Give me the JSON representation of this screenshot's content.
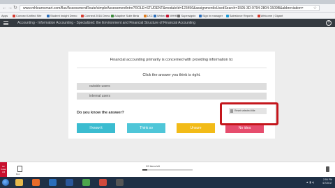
{
  "browser": {
    "url": "www.mhlearnsmart.com/flux/AssessmentRoute/simpleAssessmentIntro?ROLE=STUDENT&moduleId=123456&assignmentIsUsedSearch=1505-3D-9794-2804-1509B&abbreviation=",
    "nav_glyphs": [
      "←",
      "→",
      "↻"
    ],
    "bookmarks_label": "Apps",
    "bookmarks": [
      {
        "label": "Connect Unified Site",
        "color": "#d63b2f"
      },
      {
        "label": "Student Insight Demo",
        "color": "#2a6ebb"
      },
      {
        "label": "Connect 2016 Demo",
        "color": "#d63b2f"
      },
      {
        "label": "Adaptive Suite Beta",
        "color": "#3b8b3b"
      },
      {
        "label": "LXC",
        "color": "#e07b1a"
      },
      {
        "label": "Webex",
        "color": "#2a6ebb"
      },
      {
        "label": "MHHE",
        "color": "#c8102e"
      },
      {
        "label": "Supersignin",
        "color": "#6b6b6b"
      },
      {
        "label": "Sign in manager",
        "color": "#2a6ebb"
      },
      {
        "label": "Salesforce Reports",
        "color": "#1a9ad6"
      },
      {
        "label": "Welcome | Gigant",
        "color": "#d63b2f"
      }
    ]
  },
  "header": {
    "breadcrumb": "Accounting - Information Accounting - Specialized: the Environment and Financial Structure of Financial Accounting",
    "help_glyph": "?"
  },
  "question": {
    "prompt": "Financial accounting primarily is concerned with providing information to:",
    "instruction": "Click the answer you think is right.",
    "choices": [
      "outside users",
      "internal users"
    ],
    "know_prompt": "Do you know the answer?",
    "reset_label": "Reset selected title",
    "confidence": [
      {
        "label": "I know it",
        "color": "#3bbcd0"
      },
      {
        "label": "Think so",
        "color": "#4fc6d8"
      },
      {
        "label": "Unsure",
        "color": "#f2bb18"
      },
      {
        "label": "No idea",
        "color": "#e64d6d"
      }
    ]
  },
  "annotation_color": "#c4161c",
  "footer": {
    "logo_text": "Mc Graw Hill",
    "doc_label": "Doc",
    "progress_label": "0/3 items left",
    "progress_fraction": 0.1
  },
  "taskbar": {
    "apps": [
      {
        "name": "explorer",
        "color": "#e6b84c"
      },
      {
        "name": "firefox",
        "color": "#e76b2a"
      },
      {
        "name": "outlook",
        "color": "#2a6ebb"
      },
      {
        "name": "word",
        "color": "#2b579a"
      },
      {
        "name": "chrome",
        "color": "#4ca64c"
      },
      {
        "name": "media",
        "color": "#d04a3c"
      },
      {
        "name": "app",
        "color": "#555555"
      }
    ],
    "time": "2:56 PM",
    "date": "6/7/2017"
  }
}
